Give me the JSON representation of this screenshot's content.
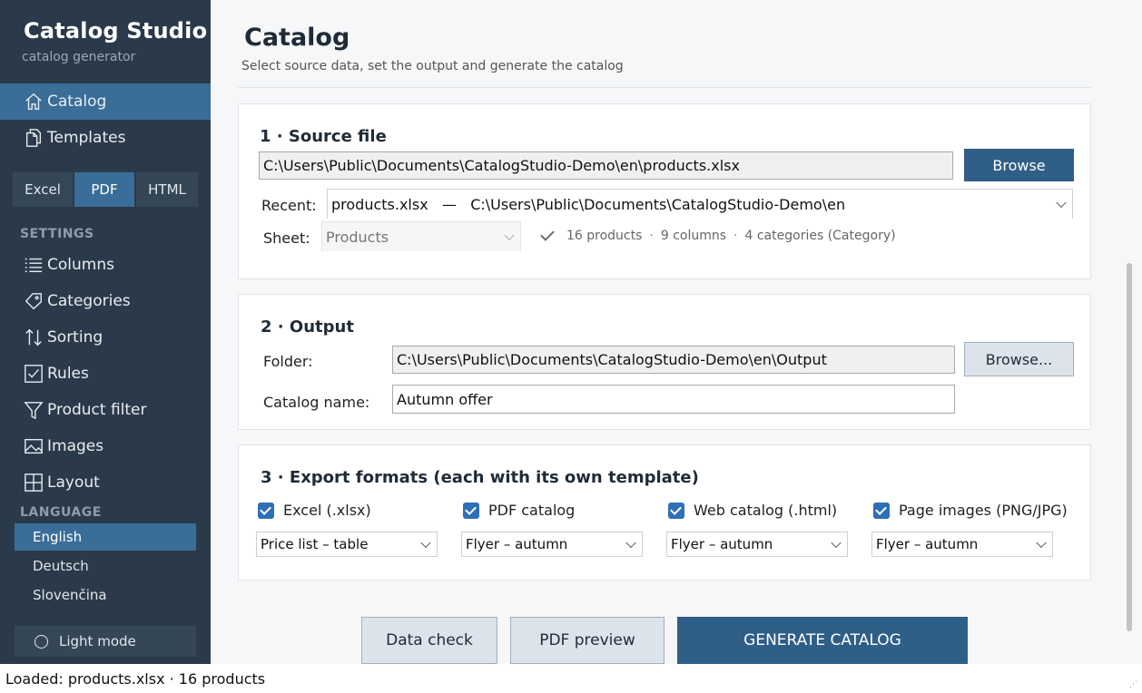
{
  "app": {
    "title": "Catalog Studio",
    "subtitle": "catalog generator"
  },
  "nav": [
    {
      "label": "Catalog",
      "icon": "home-icon",
      "active": true
    },
    {
      "label": "Templates",
      "icon": "documents-icon",
      "active": false
    }
  ],
  "format_tabs": [
    {
      "label": "Excel",
      "active": false
    },
    {
      "label": "PDF",
      "active": true
    },
    {
      "label": "HTML",
      "active": false
    }
  ],
  "settings": {
    "heading": "SETTINGS",
    "items": [
      {
        "label": "Columns",
        "icon": "list-icon"
      },
      {
        "label": "Categories",
        "icon": "tag-icon"
      },
      {
        "label": "Sorting",
        "icon": "sort-arrows-icon"
      },
      {
        "label": "Rules",
        "icon": "checkbox-icon"
      },
      {
        "label": "Product filter",
        "icon": "filter-icon"
      },
      {
        "label": "Images",
        "icon": "image-icon"
      },
      {
        "label": "Layout",
        "icon": "grid-icon"
      }
    ]
  },
  "language": {
    "heading": "LANGUAGE",
    "items": [
      {
        "label": "English",
        "active": true
      },
      {
        "label": "Deutsch",
        "active": false
      },
      {
        "label": "Slovenčina",
        "active": false
      }
    ]
  },
  "theme_toggle": {
    "label": "Light mode"
  },
  "page": {
    "title": "Catalog",
    "subtitle": "Select source data, set the output and generate the catalog"
  },
  "source": {
    "heading": "1 · Source file",
    "path": "C:\\Users\\Public\\Documents\\CatalogStudio-Demo\\en\\products.xlsx",
    "browse_label": "Browse",
    "recent_label": "Recent:",
    "recent_value": "products.xlsx   —   C:\\Users\\Public\\Documents\\CatalogStudio-Demo\\en",
    "sheet_label": "Sheet:",
    "sheet_value": "Products",
    "info": {
      "products": "16 products",
      "columns": "9 columns",
      "categories": "4 categories (Category)"
    }
  },
  "output": {
    "heading": "2 · Output",
    "folder_label": "Folder:",
    "folder_value": "C:\\Users\\Public\\Documents\\CatalogStudio-Demo\\en\\Output",
    "browse_label": "Browse...",
    "name_label": "Catalog name:",
    "name_value": "Autumn offer"
  },
  "export": {
    "heading": "3 · Export formats (each with its own template)",
    "formats": [
      {
        "label": "Excel (.xlsx)",
        "checked": true,
        "template": "Price list – table"
      },
      {
        "label": "PDF catalog",
        "checked": true,
        "template": "Flyer – autumn"
      },
      {
        "label": "Web catalog (.html)",
        "checked": true,
        "template": "Flyer – autumn"
      },
      {
        "label": "Page images (PNG/JPG)",
        "checked": true,
        "template": "Flyer – autumn"
      }
    ]
  },
  "actions": {
    "data_check": "Data check",
    "pdf_preview": "PDF preview",
    "generate": "GENERATE CATALOG"
  },
  "status_bar": {
    "text": "Loaded: products.xlsx · 16 products"
  },
  "colors": {
    "sidebar_bg": "#2b3a4a",
    "accent": "#3a6d97",
    "primary_button": "#2f5f87",
    "checkbox": "#2f6fb5"
  }
}
